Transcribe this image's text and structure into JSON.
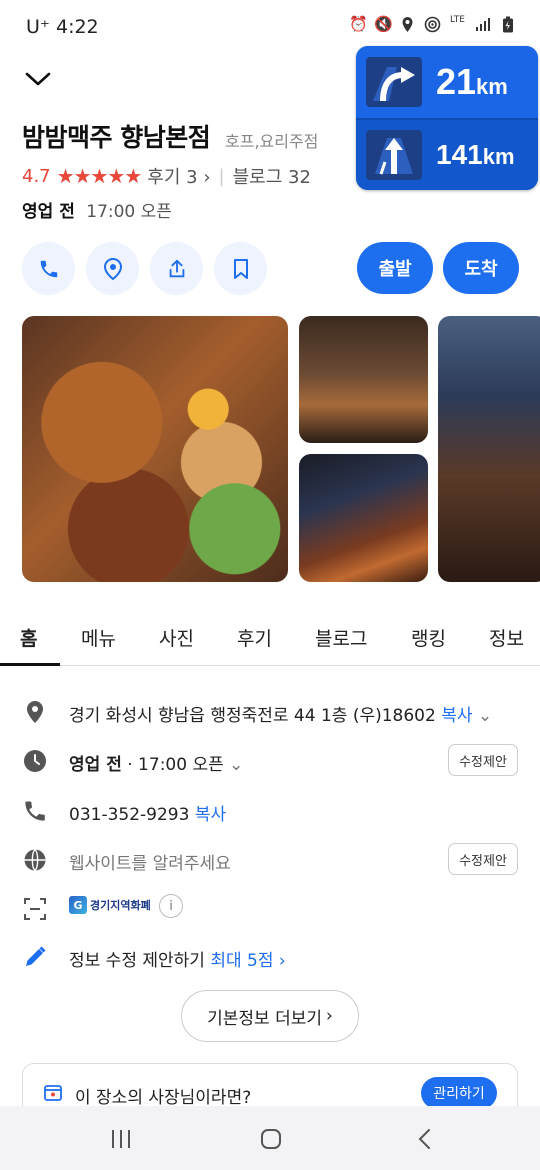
{
  "status_bar": {
    "carrier": "U⁺ 4:22",
    "icons": [
      "alarm-icon",
      "mute-icon",
      "location-icon",
      "hotspot-icon",
      "lte-icon",
      "signal-icon",
      "battery-icon"
    ]
  },
  "nav_card": {
    "upper": {
      "value": "21",
      "unit": "km",
      "icon": "turn-right-sign-icon"
    },
    "lower": {
      "value": "141",
      "unit": "km",
      "icon": "straight-ahead-sign-icon"
    }
  },
  "place": {
    "name": "밤밤맥주 향남본점",
    "category": "호프,요리주점",
    "rating": "4.7",
    "stars": "★★★★★",
    "rating_value": 4.7,
    "reviews": "후기 3",
    "blogs": "블로그 32",
    "business_status": "영업 전",
    "open_time": "17:00 오픈"
  },
  "action_buttons": [
    "phone-icon",
    "pin-icon",
    "share-icon",
    "bookmark-icon"
  ],
  "route_buttons": {
    "start": "출발",
    "arrive": "도착"
  },
  "tabs": [
    "홈",
    "메뉴",
    "사진",
    "후기",
    "블로그",
    "랭킹",
    "정보"
  ],
  "info": {
    "address": "경기 화성시 향남읍 행정죽전로 44 1층 (우)18602",
    "copy": "복사",
    "hours_status": "영업 전",
    "hours_time": "· 17:00 오픈",
    "suggest": "수정제안",
    "phone": "031-352-9293",
    "website_placeholder": "웹사이트를 알려주세요",
    "local_currency": "경기지역화폐",
    "info_glyph": "i",
    "edit_suggestion": "정보 수정 제안하기",
    "edit_reward": "최대 5점"
  },
  "more_button": "기본정보 더보기",
  "owner_banner": {
    "text": "이 장소의 사장님이라면?",
    "button": "관리하기"
  },
  "colors": {
    "accent": "#1e6ef0",
    "rating": "#e8473a"
  }
}
